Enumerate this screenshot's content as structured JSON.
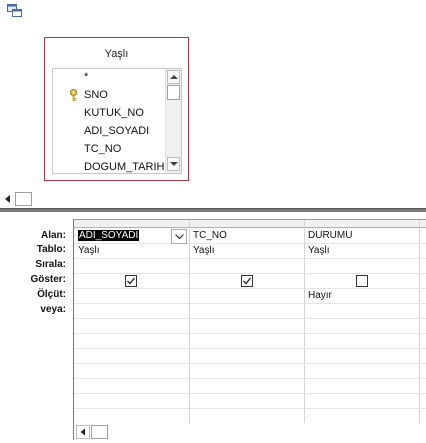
{
  "table": {
    "title": "Yaşlı",
    "fields": [
      "*",
      "SNO",
      "KUTUK_NO",
      "ADI_SOYADI",
      "TC_NO",
      "DOGUM_TARIH"
    ],
    "primary_key_field": "SNO"
  },
  "grid": {
    "row_labels": {
      "alan": "Alan:",
      "tablo": "Tablo:",
      "sirala": "Sırala:",
      "goster": "Göster:",
      "olcut": "Ölçüt:",
      "veya": "veya:"
    },
    "columns": [
      {
        "field": "ADI_SOYADI",
        "table": "Yaşlı",
        "show": true,
        "criteria": ""
      },
      {
        "field": "TC_NO",
        "table": "Yaşlı",
        "show": true,
        "criteria": ""
      },
      {
        "field": "DURUMU",
        "table": "Yaşlı",
        "show": false,
        "criteria": "Hayır"
      }
    ]
  },
  "colors": {
    "table_border": "#b2363e",
    "splitter": "#7a7a7a",
    "selection": "#000000"
  },
  "icons": {
    "app": "query-design-icon",
    "key": "primary-key-icon",
    "scroll_up": "arrow-up-icon",
    "scroll_down": "arrow-down-icon",
    "scroll_left": "arrow-left-icon",
    "dropdown": "chevron-down-icon",
    "check": "checkmark-icon"
  }
}
